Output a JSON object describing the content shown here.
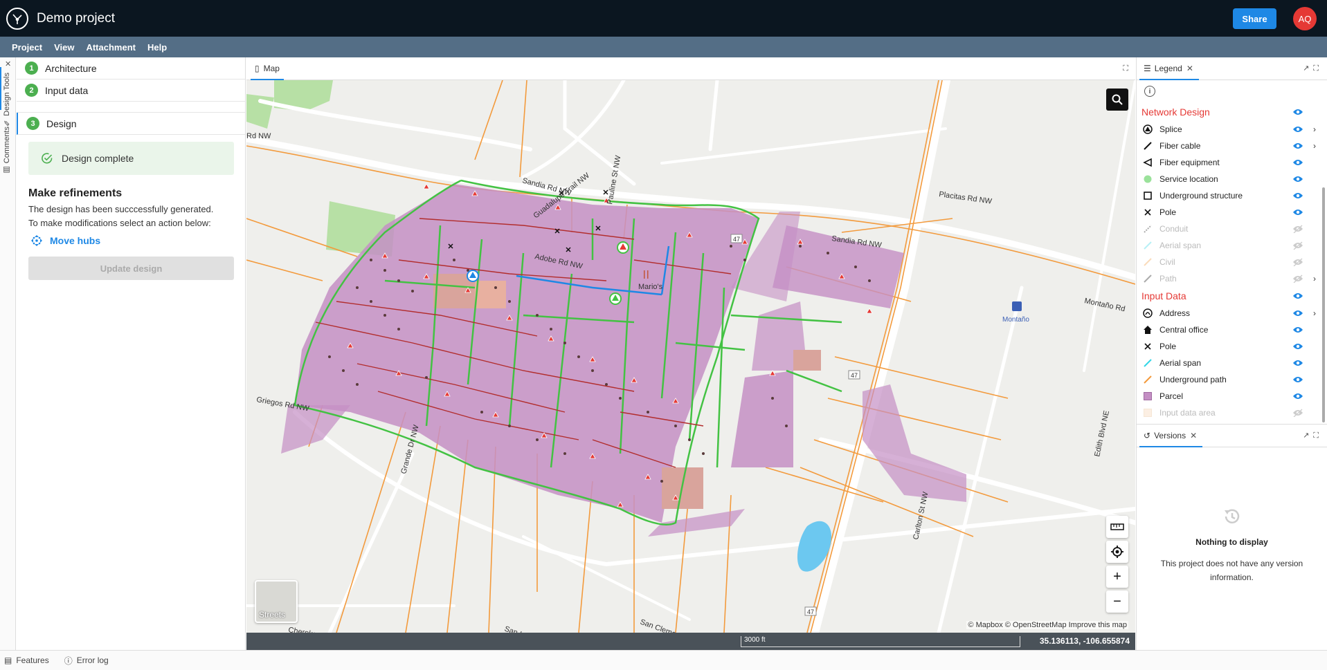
{
  "app": {
    "title": "Demo project",
    "share_label": "Share",
    "avatar_initials": "AQ"
  },
  "menu": [
    "Project",
    "View",
    "Attachment",
    "Help"
  ],
  "side_tabs": {
    "design_tools": "Design Tools",
    "comments": "Comments"
  },
  "steps": [
    {
      "num": "1",
      "label": "Architecture"
    },
    {
      "num": "2",
      "label": "Input data"
    },
    {
      "num": "3",
      "label": "Design"
    }
  ],
  "design": {
    "complete_label": "Design complete",
    "refine_title": "Make refinements",
    "refine_desc_line1": "The design has been succcessfully generated.",
    "refine_desc_line2": "To make modifications select an action below:",
    "move_hubs_label": "Move hubs",
    "update_label": "Update design"
  },
  "map": {
    "tab_label": "Map",
    "basemap_label": "Streets",
    "attribution": "© Mapbox © OpenStreetMap  Improve this map",
    "scale_label": "3000 ft",
    "coordinates": "35.136113, -106.655874",
    "streets": [
      "Sandia Rd NW",
      "Guadalupe Trail NW",
      "Pauline St NW",
      "Placitas Rd NW",
      "Sandia Rd NW",
      "Adobe Rd NW",
      "Mario's",
      "Montaño Rd",
      "Montaño",
      "Griegos Rd NW",
      "Grande Dr NW",
      "Edith Blvd NE",
      "Carlton St NW",
      "San Clemente Ave NW",
      "Cherokee Rd NW",
      "San Lorenzo",
      "Rd NW",
      "47",
      "47",
      "47"
    ]
  },
  "legend": {
    "tab_label": "Legend",
    "sections": [
      {
        "title": "Network Design",
        "items": [
          {
            "label": "Splice",
            "icon": "splice-icon",
            "dim": false,
            "chevron": true
          },
          {
            "label": "Fiber cable",
            "icon": "fiber-cable-icon",
            "dim": false,
            "chevron": true
          },
          {
            "label": "Fiber equipment",
            "icon": "fiber-equipment-icon",
            "dim": false,
            "chevron": false
          },
          {
            "label": "Service location",
            "icon": "service-location-icon",
            "dim": false,
            "chevron": false
          },
          {
            "label": "Underground structure",
            "icon": "underground-structure-icon",
            "dim": false,
            "chevron": false
          },
          {
            "label": "Pole",
            "icon": "pole-icon",
            "dim": false,
            "chevron": false
          },
          {
            "label": "Conduit",
            "icon": "conduit-icon",
            "dim": true,
            "chevron": false
          },
          {
            "label": "Aerial span",
            "icon": "aerial-span-icon",
            "dim": true,
            "chevron": false
          },
          {
            "label": "Civil",
            "icon": "civil-icon",
            "dim": true,
            "chevron": false
          },
          {
            "label": "Path",
            "icon": "path-icon",
            "dim": true,
            "chevron": true
          }
        ]
      },
      {
        "title": "Input Data",
        "items": [
          {
            "label": "Address",
            "icon": "address-icon",
            "dim": false,
            "chevron": true
          },
          {
            "label": "Central office",
            "icon": "central-office-icon",
            "dim": false,
            "chevron": false
          },
          {
            "label": "Pole",
            "icon": "pole-icon",
            "dim": false,
            "chevron": false
          },
          {
            "label": "Aerial span",
            "icon": "aerial-span-icon",
            "dim": false,
            "chevron": false
          },
          {
            "label": "Underground path",
            "icon": "underground-path-icon",
            "dim": false,
            "chevron": false
          },
          {
            "label": "Parcel",
            "icon": "parcel-icon",
            "dim": false,
            "chevron": false
          },
          {
            "label": "Input data area",
            "icon": "input-data-area-icon",
            "dim": true,
            "chevron": false
          }
        ]
      }
    ]
  },
  "versions": {
    "tab_label": "Versions",
    "empty_title": "Nothing to display",
    "empty_desc": "This project does not have any version information."
  },
  "status": {
    "features_label": "Features",
    "error_log_label": "Error log"
  },
  "colors": {
    "accent": "#1e88e5",
    "brand_dark": "#0b1620",
    "section_red": "#e53935",
    "success_green": "#4caf50",
    "parcel": "#c48fc4",
    "fiber_green": "#43c243",
    "orange_path": "#f39a3c"
  }
}
